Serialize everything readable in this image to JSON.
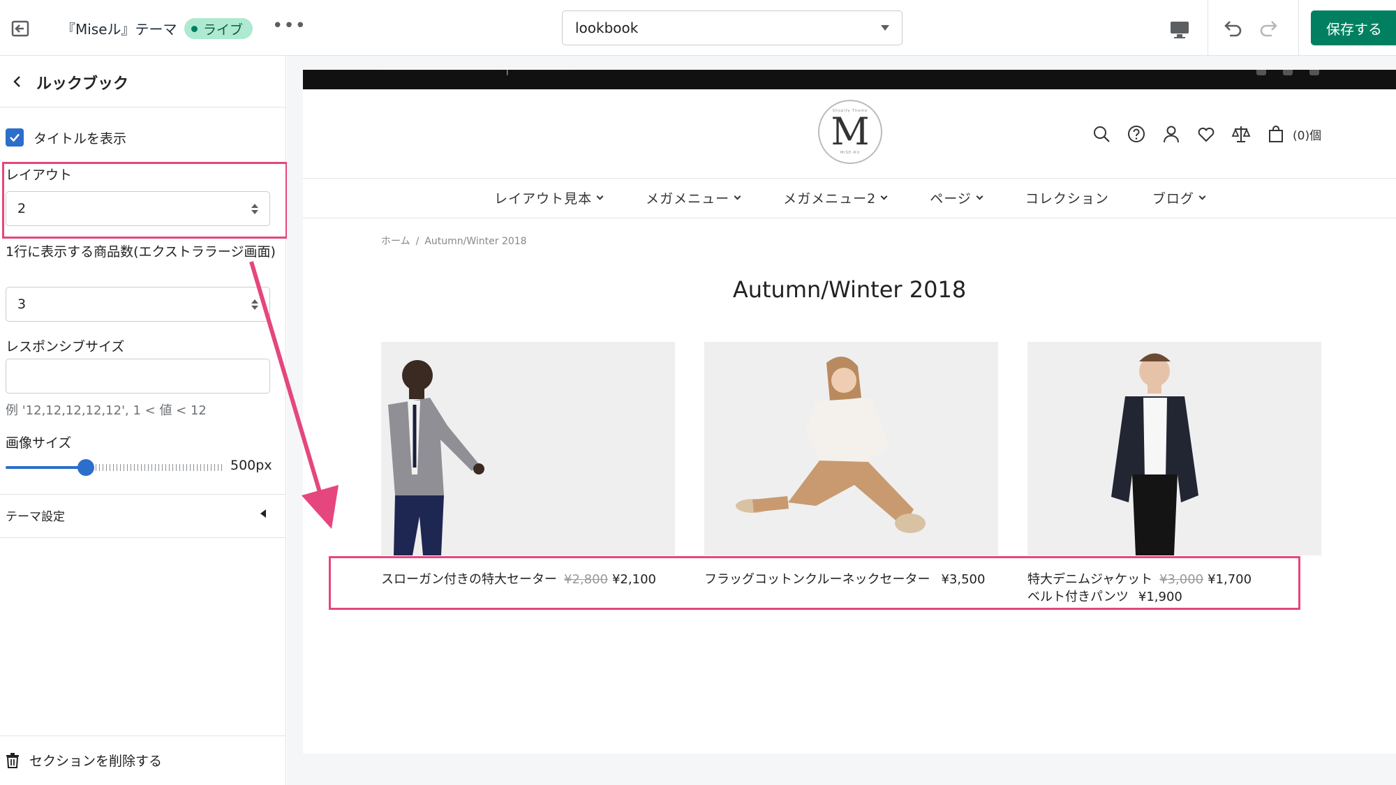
{
  "topbar": {
    "theme_name": "『Miseル』テーマ",
    "badge": "ライブ",
    "more": "•••",
    "template_select": "lookbook",
    "save_label": "保存する"
  },
  "panel": {
    "title": "ルックブック",
    "show_title_label": "タイトルを表示",
    "show_title_checked": true,
    "layout_label": "レイアウト",
    "layout_value": "2",
    "per_row_label": "1行に表示する商品数(エクストララージ画面)",
    "per_row_value": "3",
    "responsive_label": "レスポンシブサイズ",
    "responsive_value": "",
    "responsive_help": "例 '12,12,12,12,12', 1 < 値 < 12",
    "image_size_label": "画像サイズ",
    "image_size_value": "500px",
    "image_size_fraction": 0.37,
    "theme_settings": "テーマ設定",
    "delete_section": "セクションを削除する"
  },
  "colors": {
    "accent": "#2c6ecb",
    "save": "#008060",
    "highlight": "#e5467e",
    "badge_bg": "#aee9d1"
  },
  "site": {
    "logo_letter": "M",
    "logo_top": "Shopify Theme",
    "logo_bottom": "MISE-RU",
    "cart_count": "(0)個",
    "nav": [
      {
        "label": "レイアウト見本",
        "dropdown": true
      },
      {
        "label": "メガメニュー",
        "dropdown": true
      },
      {
        "label": "メガメニュー2",
        "dropdown": true
      },
      {
        "label": "ページ",
        "dropdown": true
      },
      {
        "label": "コレクション",
        "dropdown": false
      },
      {
        "label": "ブログ",
        "dropdown": true
      }
    ],
    "breadcrumb": {
      "home": "ホーム",
      "separator": "/",
      "current": "Autumn/Winter 2018"
    },
    "collection_title": "Autumn/Winter 2018",
    "products": [
      {
        "name": "スローガン付きの特大セーター",
        "old_price": "¥2,800",
        "price": "¥2,100",
        "name2": "",
        "price2": ""
      },
      {
        "name": "フラッグコットンクルーネックセーター",
        "old_price": "",
        "price": "¥3,500",
        "name2": "",
        "price2": ""
      },
      {
        "name": "特大デニムジャケット",
        "old_price": "¥3,000",
        "price": "¥1,700",
        "name2": "ベルト付きパンツ",
        "price2": "¥1,900"
      }
    ]
  },
  "icons": [
    "exit-icon",
    "desktop-icon",
    "undo-icon",
    "redo-icon",
    "back-chevron-icon",
    "checkmark-icon",
    "trash-icon",
    "search-icon",
    "help-icon",
    "account-icon",
    "heart-icon",
    "compare-icon",
    "cart-icon"
  ]
}
